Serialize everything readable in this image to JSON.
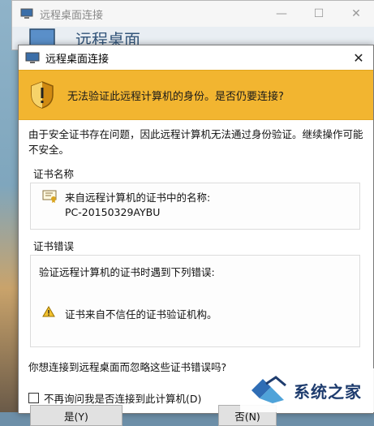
{
  "back_window": {
    "title": "远程桌面连接",
    "banner_title": "远程桌面",
    "controls": [
      "—",
      "☐",
      "✕"
    ]
  },
  "dialog": {
    "title": "远程桌面连接",
    "close_symbol": "✕",
    "warning_text": "无法验证此远程计算机的身份。是否仍要连接?",
    "intro": "由于安全证书存在问题，因此远程计算机无法通过身份验证。继续操作可能不安全。",
    "cert_group": {
      "title": "证书名称",
      "label": "来自远程计算机的证书中的名称:",
      "value": "PC-20150329AYBU"
    },
    "error_group": {
      "title": "证书错误",
      "intro": "验证远程计算机的证书时遇到下列错误:",
      "item": "证书来自不信任的证书验证机构。"
    },
    "question": "你想连接到远程桌面而忽略这些证书错误吗?",
    "checkbox_label": "不再询问我是否连接到此计算机(D)",
    "checkbox_checked": false,
    "buttons": {
      "yes": "是(Y)",
      "no": "否(N)"
    }
  },
  "watermark": {
    "text": "系统之家"
  },
  "colors": {
    "warning_banner": "#f2b530",
    "watermark_text": "#1e3c6e"
  },
  "icons": [
    "monitor-icon",
    "shield-warning-icon",
    "certificate-icon",
    "warning-triangle-icon",
    "close-icon"
  ]
}
